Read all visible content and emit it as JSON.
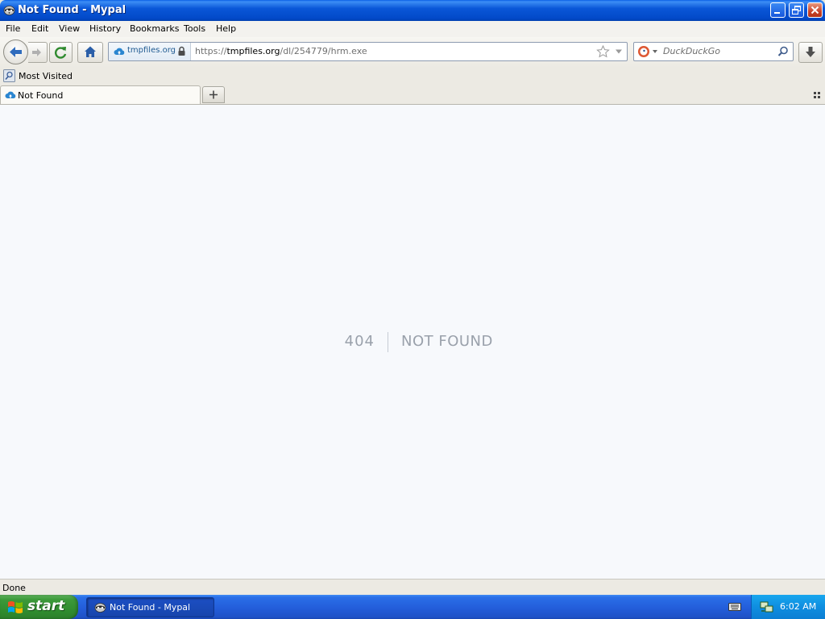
{
  "window": {
    "title": "Not Found - Mypal"
  },
  "menu": [
    "File",
    "Edit",
    "View",
    "History",
    "Bookmarks",
    "Tools",
    "Help"
  ],
  "navbar": {
    "identity_label": "tmpfiles.org",
    "url_prefix": "https://",
    "url_host": "tmpfiles.org",
    "url_path": "/dl/254779/hrm.exe",
    "search_placeholder": "DuckDuckGo"
  },
  "bookmarks": {
    "most_visited": "Most Visited"
  },
  "tabs": [
    {
      "label": "Not Found",
      "active": true
    }
  ],
  "content": {
    "error_code": "404",
    "error_message": "NOT FOUND"
  },
  "statusbar": {
    "text": "Done"
  },
  "taskbar": {
    "start_label": "start",
    "task_label": "Not Found - Mypal",
    "clock": "6:02 AM"
  },
  "colors": {
    "xp_blue": "#0a57d8",
    "start_green": "#3c9a3a",
    "content_bg": "#f7f9fc",
    "error_text": "#9aa1ab"
  },
  "icons": {
    "browser": "mypal-raccoon-icon",
    "site": "cloud-upload-icon",
    "secure": "lock-icon",
    "bookmark": "star-icon",
    "search_engine": "duckduckgo-icon",
    "download": "download-arrow-icon"
  }
}
